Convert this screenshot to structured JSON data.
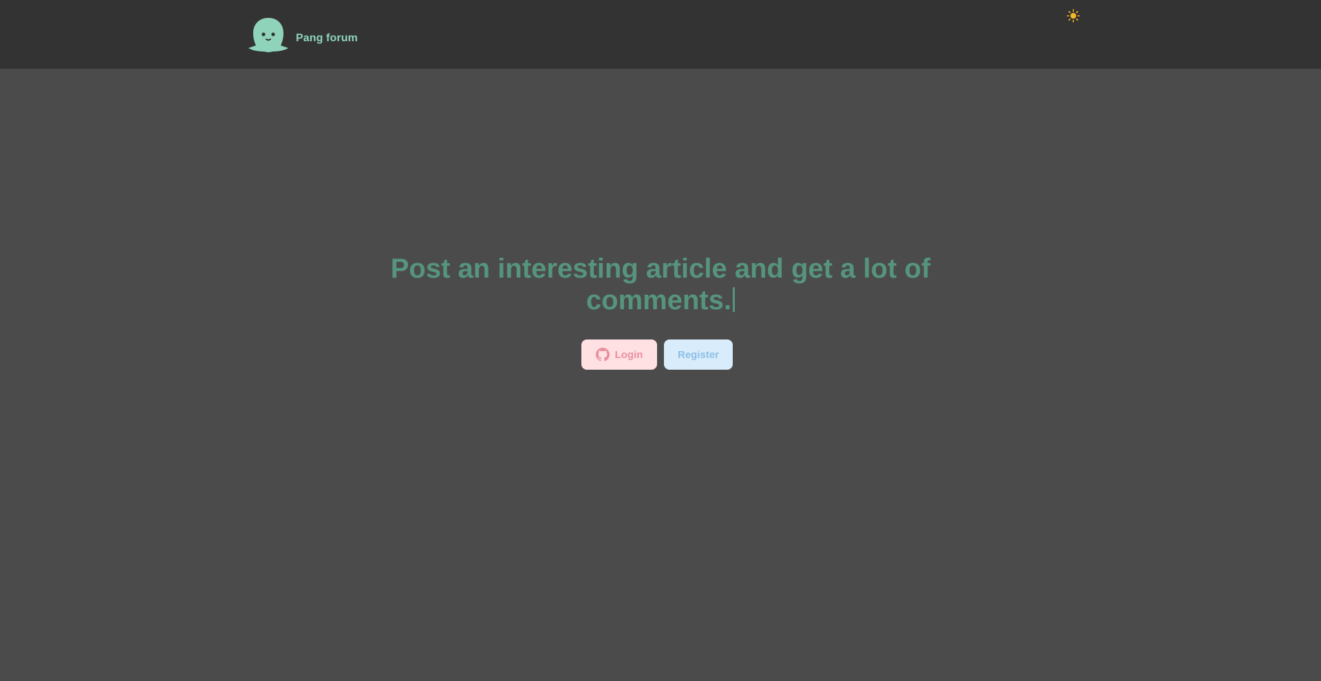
{
  "header": {
    "brand_name": "Pang forum",
    "logo_icon": "ghost-face-logo",
    "theme_icon": "sun-icon"
  },
  "hero": {
    "title": "Post an interesting article and get a lot of comments."
  },
  "actions": {
    "login_label": "Login",
    "login_icon": "github-icon",
    "register_label": "Register"
  },
  "colors": {
    "page_background": "#4b4b4b",
    "header_background": "#333333",
    "brand_accent": "#8fd3bb",
    "title_color": "#56947d",
    "login_bg": "#ffe0e3",
    "login_text": "#e8909e",
    "register_bg": "#d8ecfb",
    "register_text": "#8cc0e6"
  }
}
